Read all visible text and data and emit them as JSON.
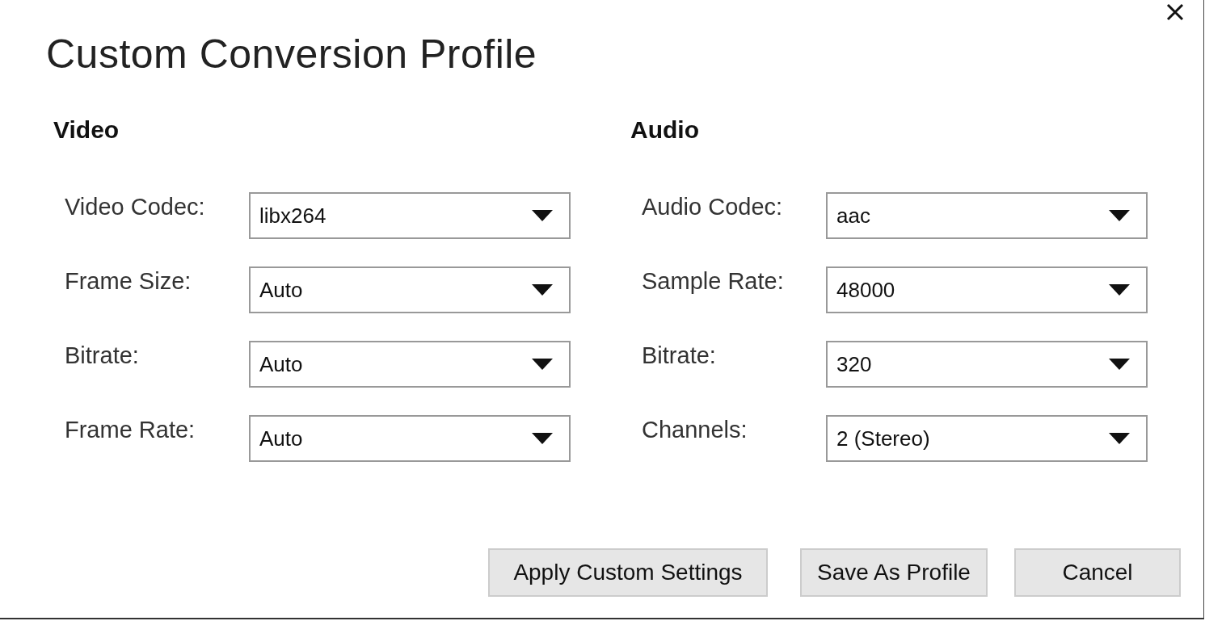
{
  "window": {
    "title": "Custom Conversion Profile"
  },
  "sections": [
    {
      "heading": "Video",
      "fields": [
        {
          "label": "Video Codec:",
          "value": "libx264"
        },
        {
          "label": "Frame Size:",
          "value": "Auto"
        },
        {
          "label": "Bitrate:",
          "value": "Auto"
        },
        {
          "label": "Frame Rate:",
          "value": "Auto"
        }
      ]
    },
    {
      "heading": "Audio",
      "fields": [
        {
          "label": "Audio Codec:",
          "value": "aac"
        },
        {
          "label": "Sample Rate:",
          "value": "48000"
        },
        {
          "label": "Bitrate:",
          "value": "320"
        },
        {
          "label": "Channels:",
          "value": "2 (Stereo)"
        }
      ]
    }
  ],
  "buttons": [
    "Apply Custom Settings",
    "Save As Profile",
    "Cancel"
  ]
}
